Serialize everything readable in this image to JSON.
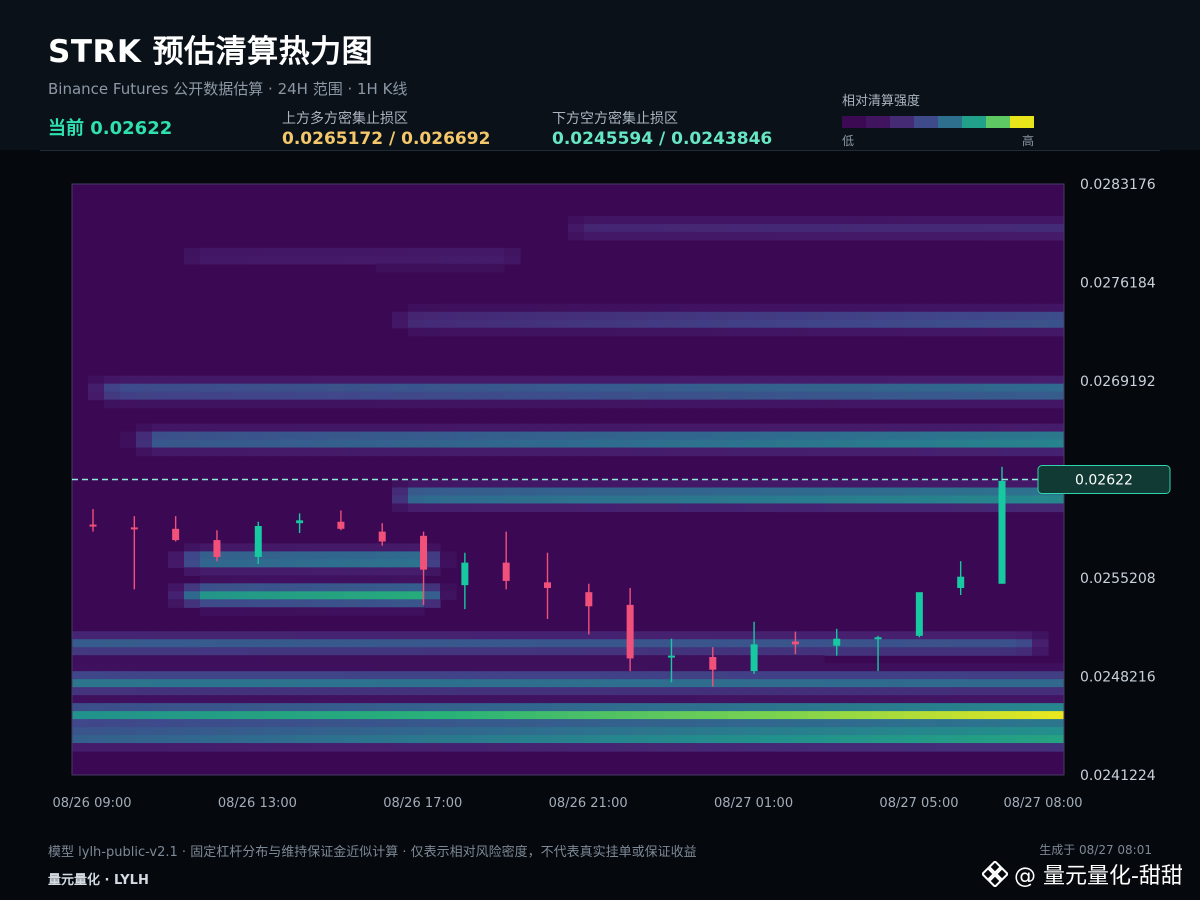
{
  "header": {
    "title": "STRK 预估清算热力图",
    "subtitle": "Binance Futures 公开数据估算 · 24H 范围 · 1H K线",
    "current_text": "当前 0.02622",
    "upper_zone_label": "上方多方密集止损区",
    "upper_zone_value": "0.0265172 / 0.026692",
    "lower_zone_label": "下方空方密集止损区",
    "lower_zone_value": "0.0245594 / 0.0243846"
  },
  "legend": {
    "title": "相对清算强度",
    "low": "低",
    "high": "高",
    "colors": [
      "#3b0a52",
      "#41145f",
      "#452a74",
      "#3e4a8a",
      "#2f6f8e",
      "#21a08a",
      "#5ec962",
      "#e8e51a"
    ]
  },
  "footer": {
    "note": "模型 lylh-public-v2.1 · 固定杠杆分布与维持保证金近似计算 · 仅表示相对风险密度，不代表真实挂单或保证收益",
    "brand": "量元量化 · LYLH",
    "generated": "生成于 08/27 08:01",
    "watermark": "@ 量元量化-甜甜"
  },
  "chart_data": {
    "type": "heatmap",
    "overlay": "candlestick",
    "title": "",
    "xlabel": "",
    "ylabel": "",
    "ylim": [
      0.0241224,
      0.0283176
    ],
    "xlim_hours": [
      0,
      23
    ],
    "x_start": "08/26 09:00",
    "x_interval": "1H",
    "y_ticks": [
      "0.0283176",
      "0.0276184",
      "0.0269192",
      "0.0262200",
      "0.0255208",
      "0.0248216",
      "0.0241224"
    ],
    "y_tick_labels": [
      "0.0283176",
      "0.0276184",
      "0.0269192",
      "0.0255208",
      "0.0248216",
      "0.0241224"
    ],
    "x_ticks": [
      {
        "hour": 0,
        "label": "08/26 09:00"
      },
      {
        "hour": 4,
        "label": "08/26 13:00"
      },
      {
        "hour": 8,
        "label": "08/26 17:00"
      },
      {
        "hour": 12,
        "label": "08/26 21:00"
      },
      {
        "hour": 16,
        "label": "08/27 01:00"
      },
      {
        "hour": 20,
        "label": "08/27 05:00"
      },
      {
        "hour": 23,
        "label": "08/27 08:00"
      }
    ],
    "current_price": 0.02622,
    "current_label": "0.02622",
    "colors": {
      "up": "#17c9a0",
      "down": "#f0507a",
      "current_line": "#8fe8d8",
      "frame": "#4a3a66"
    },
    "candles": [
      {
        "time": "08/26 09:00",
        "open": 0.0259,
        "high": 0.02601,
        "low": 0.02585,
        "close": 0.02589
      },
      {
        "time": "08/26 10:00",
        "open": 0.02588,
        "high": 0.02596,
        "low": 0.02544,
        "close": 0.02587
      },
      {
        "time": "08/26 11:00",
        "open": 0.02587,
        "high": 0.02596,
        "low": 0.02578,
        "close": 0.02579
      },
      {
        "time": "08/26 12:00",
        "open": 0.02579,
        "high": 0.02586,
        "low": 0.02564,
        "close": 0.02567
      },
      {
        "time": "08/26 13:00",
        "open": 0.02567,
        "high": 0.02592,
        "low": 0.02562,
        "close": 0.02589
      },
      {
        "time": "08/26 14:00",
        "open": 0.02591,
        "high": 0.02598,
        "low": 0.02584,
        "close": 0.02593
      },
      {
        "time": "08/26 15:00",
        "open": 0.02592,
        "high": 0.026,
        "low": 0.02586,
        "close": 0.02587
      },
      {
        "time": "08/26 16:00",
        "open": 0.02585,
        "high": 0.02591,
        "low": 0.02575,
        "close": 0.02578
      },
      {
        "time": "08/26 17:00",
        "open": 0.02582,
        "high": 0.02585,
        "low": 0.02533,
        "close": 0.02558
      },
      {
        "time": "08/26 18:00",
        "open": 0.02547,
        "high": 0.0257,
        "low": 0.0253,
        "close": 0.02563
      },
      {
        "time": "08/26 19:00",
        "open": 0.02563,
        "high": 0.02585,
        "low": 0.02544,
        "close": 0.0255
      },
      {
        "time": "08/26 20:00",
        "open": 0.02549,
        "high": 0.0257,
        "low": 0.02523,
        "close": 0.02545
      },
      {
        "time": "08/26 21:00",
        "open": 0.02542,
        "high": 0.02548,
        "low": 0.02512,
        "close": 0.02532
      },
      {
        "time": "08/26 22:00",
        "open": 0.02533,
        "high": 0.02545,
        "low": 0.02486,
        "close": 0.02495
      },
      {
        "time": "08/26 23:00",
        "open": 0.02496,
        "high": 0.02509,
        "low": 0.02478,
        "close": 0.02497
      },
      {
        "time": "08/27 00:00",
        "open": 0.02496,
        "high": 0.02503,
        "low": 0.02475,
        "close": 0.02487
      },
      {
        "time": "08/27 01:00",
        "open": 0.02486,
        "high": 0.02521,
        "low": 0.02484,
        "close": 0.02505
      },
      {
        "time": "08/27 02:00",
        "open": 0.02507,
        "high": 0.02514,
        "low": 0.02498,
        "close": 0.02505
      },
      {
        "time": "08/27 03:00",
        "open": 0.02504,
        "high": 0.02516,
        "low": 0.02497,
        "close": 0.02509
      },
      {
        "time": "08/27 04:00",
        "open": 0.02509,
        "high": 0.02511,
        "low": 0.02486,
        "close": 0.0251
      },
      {
        "time": "08/27 05:00",
        "open": 0.02511,
        "high": 0.02538,
        "low": 0.0251,
        "close": 0.02542
      },
      {
        "time": "08/27 06:00",
        "open": 0.02545,
        "high": 0.02564,
        "low": 0.0254,
        "close": 0.02553
      },
      {
        "time": "08/27 07:00",
        "open": 0.02548,
        "high": 0.02631,
        "low": 0.02548,
        "close": 0.02621
      }
    ],
    "heat_bands": [
      {
        "price": 0.02455,
        "hour_start": 0,
        "hour_end": 23,
        "intensity": 0.6,
        "intensity_end": 1.0
      },
      {
        "price": 0.0244,
        "hour_start": 0,
        "hour_end": 23,
        "intensity": 0.45,
        "intensity_end": 0.75
      },
      {
        "price": 0.02478,
        "hour_start": 0,
        "hour_end": 23,
        "intensity": 0.5,
        "intensity_end": 0.45
      },
      {
        "price": 0.02505,
        "hour_start": 0,
        "hour_end": 22,
        "intensity": 0.4,
        "intensity_end": 0.35
      },
      {
        "price": 0.0254,
        "hour_start": 3,
        "hour_end": 8,
        "intensity": 0.62,
        "intensity_end": 0.72
      },
      {
        "price": 0.02565,
        "hour_start": 3,
        "hour_end": 8,
        "intensity": 0.5,
        "intensity_end": 0.55
      },
      {
        "price": 0.0261,
        "hour_start": 8,
        "hour_end": 23,
        "intensity": 0.5,
        "intensity_end": 0.62
      },
      {
        "price": 0.0265,
        "hour_start": 2,
        "hour_end": 23,
        "intensity": 0.42,
        "intensity_end": 0.62
      },
      {
        "price": 0.02685,
        "hour_start": 1,
        "hour_end": 23,
        "intensity": 0.35,
        "intensity_end": 0.5
      },
      {
        "price": 0.02735,
        "hour_start": 8,
        "hour_end": 23,
        "intensity": 0.22,
        "intensity_end": 0.4
      },
      {
        "price": 0.028,
        "hour_start": 12,
        "hour_end": 23,
        "intensity": 0.18,
        "intensity_end": 0.2
      },
      {
        "price": 0.0278,
        "hour_start": 3,
        "hour_end": 10,
        "intensity": 0.12,
        "intensity_end": 0.14
      }
    ]
  }
}
